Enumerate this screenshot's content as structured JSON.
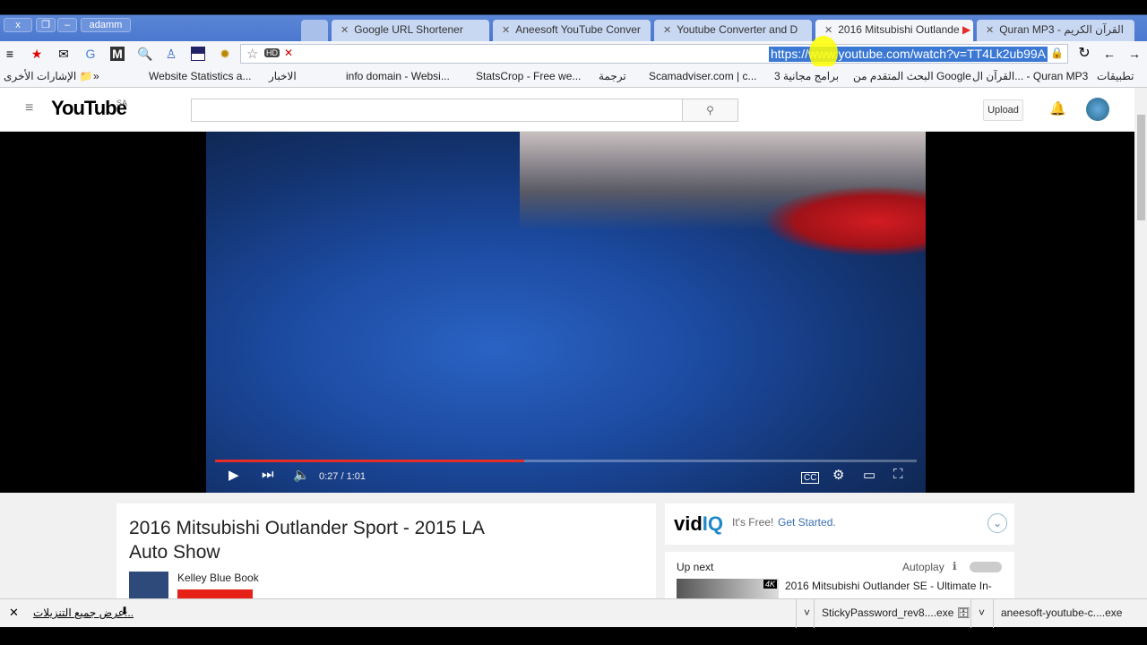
{
  "window": {
    "user": "adamm",
    "close": "x"
  },
  "tabs": [
    {
      "label": "Google URL Shortener"
    },
    {
      "label": "Aneesoft YouTube Conver"
    },
    {
      "label": "Youtube Converter and D"
    },
    {
      "label": "2016 Mitsubishi Outlande",
      "active": true
    },
    {
      "label": "Quran MP3 - القرآن الكريم"
    }
  ],
  "omnibox": {
    "url": "https://www.youtube.com/watch?v=TT4Lk2ub99A"
  },
  "bookmarks": {
    "apps": "تطبيقات",
    "items": [
      "القرآن ال... - Quran MP3",
      "البحث المتقدم من Google",
      "3 برامج مجانية",
      "Scamadviser.com | c...",
      "ترجمة",
      "StatsCrop - Free we...",
      "info domain - Websi...",
      "الاخبار",
      "Website Statistics a..."
    ],
    "more": "»",
    "other": "الإشارات الأخرى"
  },
  "youtube": {
    "logo": "YouTube",
    "region": "SA",
    "search_placeholder": "",
    "upload": "Upload"
  },
  "player": {
    "time": "0:27 / 1:01",
    "progress": 0.44
  },
  "video": {
    "title": "2016 Mitsubishi Outlander Sport - 2015 LA Auto Show",
    "channel": "Kelley Blue Book"
  },
  "vidiq": {
    "logo_a": "vid",
    "logo_b": "IQ",
    "free": "It's Free!",
    "cta": "Get Started."
  },
  "upnext": {
    "label": "Up next",
    "autoplay": "Autoplay",
    "next_title": "2016 Mitsubishi Outlander SE - Ultimate In-",
    "badge": "4K"
  },
  "downloads": {
    "show_all": "عرض جميع التنزيلات...",
    "files": [
      "StickyPassword_rev8....exe",
      "aneesoft-youtube-c....exe"
    ]
  }
}
